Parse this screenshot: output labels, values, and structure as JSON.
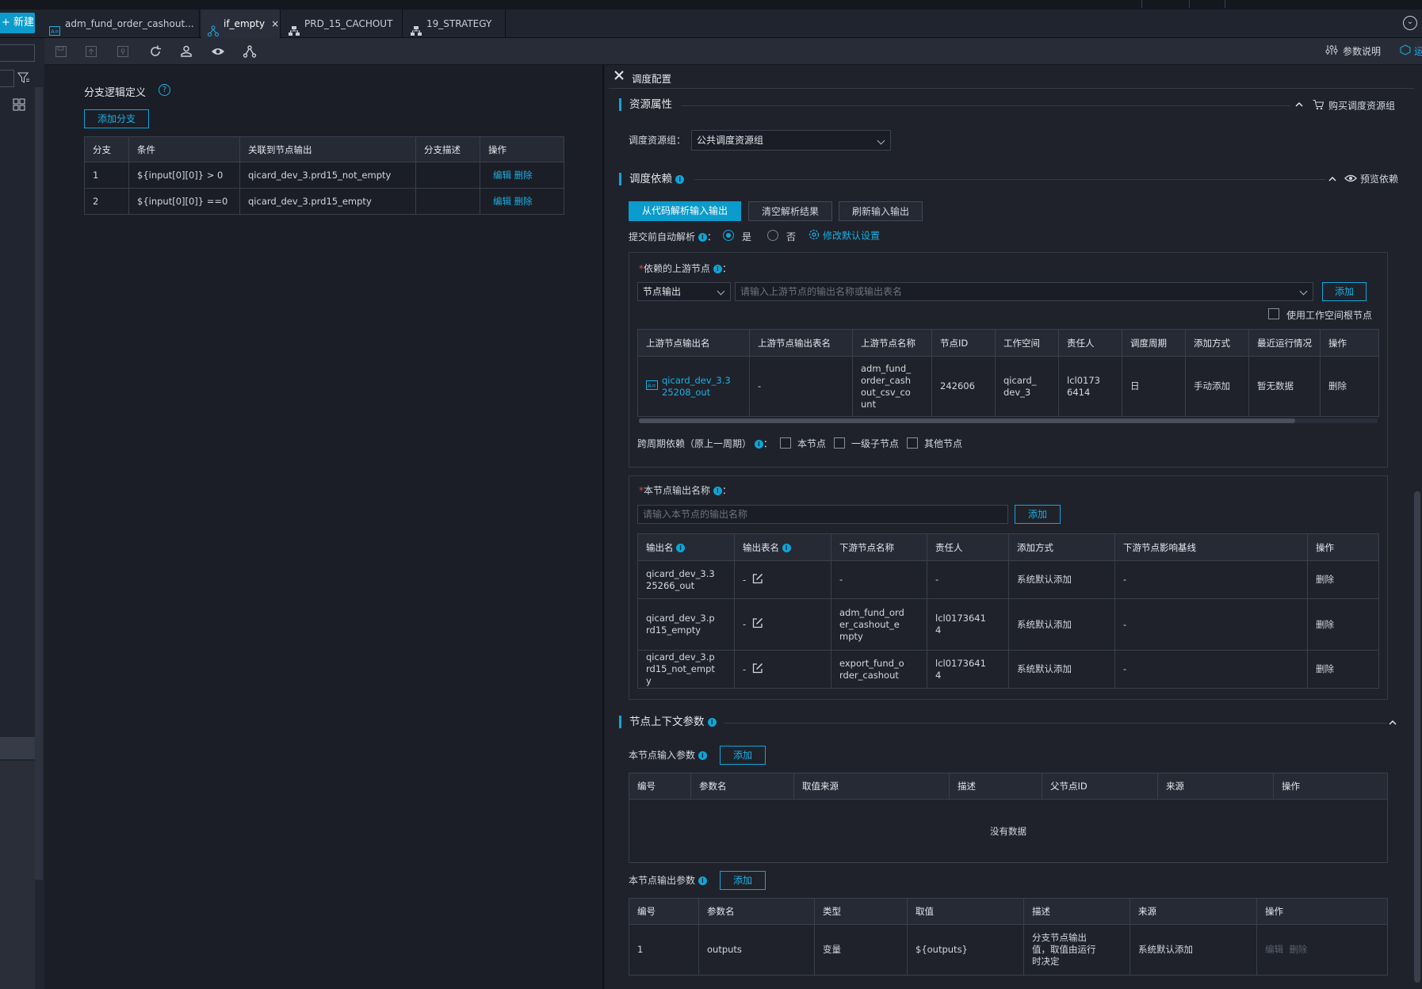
{
  "app": {
    "new_label": "新建"
  },
  "tabs": [
    {
      "label": "adm_fund_order_cashout..."
    },
    {
      "label": "if_empty",
      "close": "×"
    },
    {
      "label": "PRD_15_CACHOUT"
    },
    {
      "label": "19_STRATEGY"
    }
  ],
  "toolbar": {
    "param_help": "参数说明",
    "right_edge": "运"
  },
  "branch": {
    "title": "分支逻辑定义",
    "add_button": "添加分支",
    "columns": [
      "分支",
      "条件",
      "关联到节点输出",
      "分支描述",
      "操作"
    ],
    "rows": [
      {
        "id": "1",
        "cond": "${input[0][0]} > 0",
        "output": "qicard_dev_3.prd15_not_empty",
        "desc": "",
        "edit": "编辑",
        "del": "删除"
      },
      {
        "id": "2",
        "cond": "${input[0][0]} ==0",
        "output": "qicard_dev_3.prd15_empty",
        "desc": "",
        "edit": "编辑",
        "del": "删除"
      }
    ]
  },
  "config": {
    "title": "调度配置",
    "resource": {
      "title": "资源属性",
      "buy_link": "购买调度资源组",
      "group_label": "调度资源组：",
      "group_value": "公共调度资源组"
    },
    "dependency": {
      "title": "调度依赖",
      "preview": "预览依赖",
      "btn_parse": "从代码解析输入输出",
      "btn_clear": "清空解析结果",
      "btn_refresh": "刷新输入输出",
      "auto_parse_label": "提交前自动解析",
      "yes": "是",
      "no": "否",
      "modify_default": "修改默认设置",
      "upstream_label": "依赖的上游节点",
      "upstream_type": "节点输出",
      "upstream_placeholder": "请输入上游节点的输出名称或输出表名",
      "add": "添加",
      "use_root": "使用工作空间根节点",
      "up_columns": [
        "上游节点输出名",
        "上游节点输出表名",
        "上游节点名称",
        "节点ID",
        "工作空间",
        "责任人",
        "调度周期",
        "添加方式",
        "最近运行情况",
        "操作"
      ],
      "up_row": {
        "output": "qicard_dev_3.325208_out",
        "table": "-",
        "name": "adm_fund_order_cashout_csv_count",
        "id": "242606",
        "workspace": "qicard_dev_3",
        "owner": "lcl01736414",
        "cycle": "日",
        "method": "手动添加",
        "last_run": "暂无数据",
        "op": "删除"
      },
      "cross_label": "跨周期依赖（原上一周期）",
      "cross_opts": [
        "本节点",
        "一级子节点",
        "其他节点"
      ]
    },
    "outputs": {
      "label": "本节点输出名称",
      "placeholder": "请输入本节点的输出名称",
      "add": "添加",
      "columns": [
        "输出名",
        "输出表名",
        "下游节点名称",
        "责任人",
        "添加方式",
        "下游节点影响基线",
        "操作"
      ],
      "rows": [
        {
          "name": "qicard_dev_3.325266_out",
          "table": "-",
          "down": "-",
          "down_link": false,
          "owner": "-",
          "method": "系统默认添加",
          "baseline": "-",
          "op": "删除"
        },
        {
          "name": "qicard_dev_3.prd15_empty",
          "table": "-",
          "down": "adm_fund_order_cashout_empty",
          "down_link": true,
          "owner": "lcl01736414",
          "method": "系统默认添加",
          "baseline": "-",
          "op": "删除"
        },
        {
          "name": "qicard_dev_3.prd15_not_empty",
          "table": "-",
          "down": "export_fund_order_cashout",
          "down_link": true,
          "owner": "lcl01736414",
          "method": "系统默认添加",
          "baseline": "-",
          "op": "删除"
        }
      ]
    },
    "context": {
      "title": "节点上下文参数",
      "input_label": "本节点输入参数",
      "input_add": "添加",
      "input_columns": [
        "编号",
        "参数名",
        "取值来源",
        "描述",
        "父节点ID",
        "来源",
        "操作"
      ],
      "no_data": "没有数据",
      "output_label": "本节点输出参数",
      "output_add": "添加",
      "output_columns": [
        "编号",
        "参数名",
        "类型",
        "取值",
        "描述",
        "来源",
        "操作"
      ],
      "output_row": {
        "no": "1",
        "name": "outputs",
        "type": "变量",
        "value": "${outputs}",
        "desc": "分支节点输出值，取值由运行时决定",
        "source": "系统默认添加",
        "edit": "编辑",
        "del": "删除"
      }
    }
  }
}
